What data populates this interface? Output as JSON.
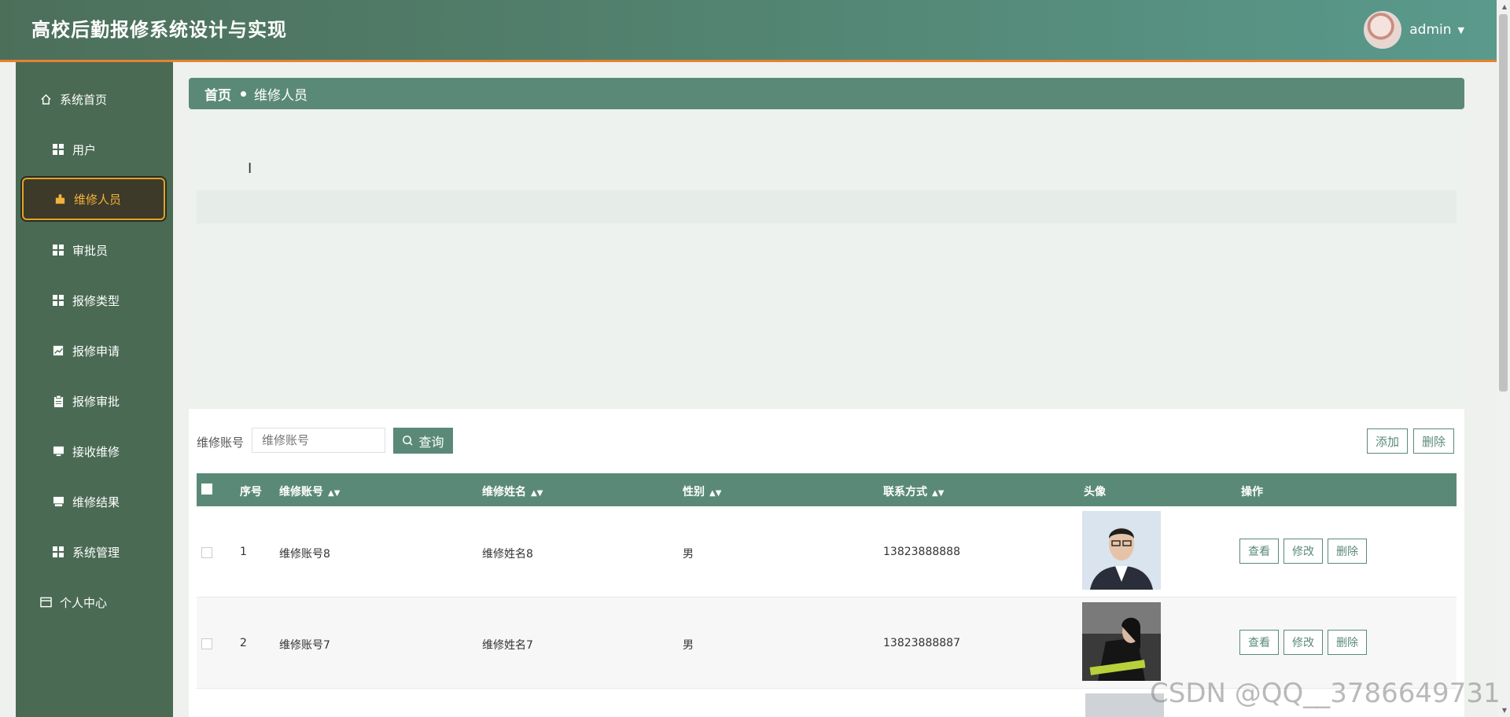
{
  "app": {
    "title": "高校后勤报修系统设计与实现",
    "user": "admin"
  },
  "sidebar": {
    "items": [
      {
        "label": "系统首页",
        "icon": "home-icon"
      },
      {
        "label": "用户",
        "icon": "grid-icon"
      },
      {
        "label": "维修人员",
        "icon": "puzzle-icon",
        "active": true
      },
      {
        "label": "审批员",
        "icon": "grid-icon"
      },
      {
        "label": "报修类型",
        "icon": "grid-icon"
      },
      {
        "label": "报修申请",
        "icon": "chart-icon"
      },
      {
        "label": "报修审批",
        "icon": "clipboard-icon"
      },
      {
        "label": "接收维修",
        "icon": "monitor-icon"
      },
      {
        "label": "维修结果",
        "icon": "printer-icon"
      },
      {
        "label": "系统管理",
        "icon": "grid-icon"
      },
      {
        "label": "个人中心",
        "icon": "wallet-icon"
      }
    ]
  },
  "breadcrumb": {
    "home": "首页",
    "current": "维修人员"
  },
  "search": {
    "label": "维修账号",
    "placeholder": "维修账号",
    "button": "查询"
  },
  "toolbar": {
    "add": "添加",
    "delete": "删除"
  },
  "table": {
    "columns": [
      "序号",
      "维修账号",
      "维修姓名",
      "性别",
      "联系方式",
      "头像",
      "操作"
    ],
    "rows": [
      {
        "index": "1",
        "account": "维修账号8",
        "name": "维修姓名8",
        "gender": "男",
        "phone": "13823888888"
      },
      {
        "index": "2",
        "account": "维修账号7",
        "name": "维修姓名7",
        "gender": "男",
        "phone": "13823888887"
      }
    ],
    "actions": {
      "view": "查看",
      "edit": "修改",
      "delete": "删除"
    }
  },
  "watermark": "CSDN @QQ__3786649731",
  "colors": {
    "primary": "#5a8a77",
    "sidebar": "#4a6a53",
    "accent": "#e0a42a",
    "header_border": "#e8812f"
  }
}
